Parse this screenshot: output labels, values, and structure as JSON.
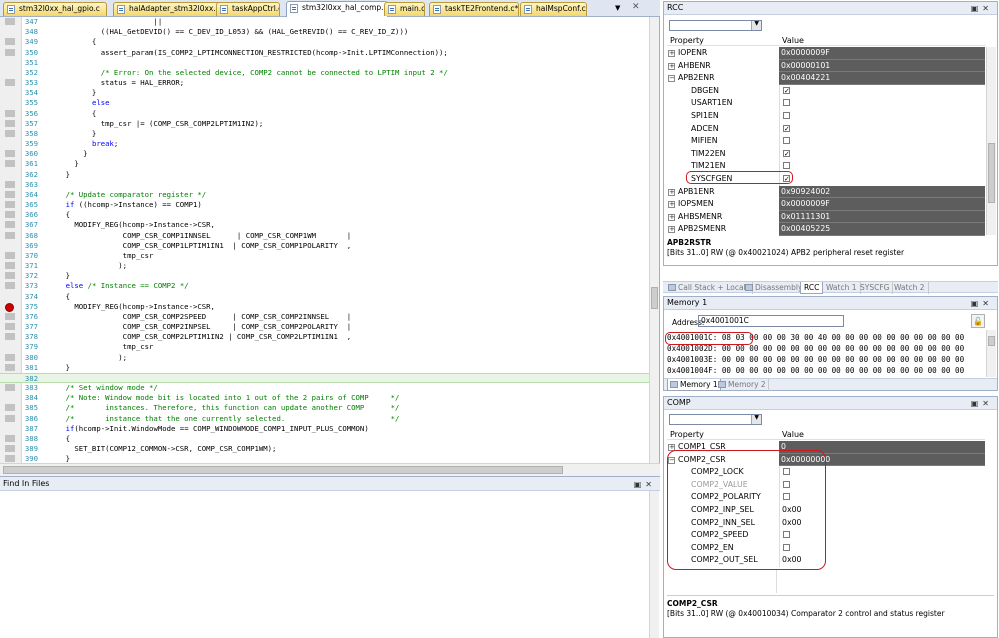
{
  "tabs": [
    {
      "label": "stm32l0xx_hal_gpio.c"
    },
    {
      "label": "halAdapter_stm32l0xx.c"
    },
    {
      "label": "taskAppCtrl.c"
    },
    {
      "label": "stm32l0xx_hal_comp.c"
    },
    {
      "label": "main.c"
    },
    {
      "label": "taskTE2Frontend.c*"
    },
    {
      "label": "halMspConf.c"
    }
  ],
  "code_lines": [
    {
      "n": "347",
      "t": "                        ||"
    },
    {
      "n": "348",
      "t": "            ((HAL_GetDEVID() == C_DEV_ID_L053) && (HAL_GetREVID() == C_REV_ID_Z)))"
    },
    {
      "n": "349",
      "t": "          {"
    },
    {
      "n": "350",
      "t": "            assert_param(IS_COMP2_LPTIMCONNECTION_RESTRICTED(hcomp->Init.LPTIMConnection));"
    },
    {
      "n": "351",
      "t": ""
    },
    {
      "n": "352",
      "t": "            /* Error: On the selected device, COMP2 cannot be connected to LPTIM input 2 */"
    },
    {
      "n": "353",
      "t": "            status = HAL_ERROR;"
    },
    {
      "n": "354",
      "t": "          }"
    },
    {
      "n": "355",
      "t": "          else"
    },
    {
      "n": "356",
      "t": "          {"
    },
    {
      "n": "357",
      "t": "            tmp_csr |= (COMP_CSR_COMP2LPTIM1IN2);"
    },
    {
      "n": "358",
      "t": "          }"
    },
    {
      "n": "359",
      "t": "          break;"
    },
    {
      "n": "360",
      "t": "        }"
    },
    {
      "n": "361",
      "t": "      }"
    },
    {
      "n": "362",
      "t": "    }"
    },
    {
      "n": "363",
      "t": ""
    },
    {
      "n": "364",
      "t": "    /* Update comparator register */"
    },
    {
      "n": "365",
      "t": "    if ((hcomp->Instance) == COMP1)"
    },
    {
      "n": "366",
      "t": "    {"
    },
    {
      "n": "367",
      "t": "      MODIFY_REG(hcomp->Instance->CSR,"
    },
    {
      "n": "368",
      "t": "                 COMP_CSR_COMP1INNSEL      | COMP_CSR_COMP1WM       |"
    },
    {
      "n": "369",
      "t": "                 COMP_CSR_COMP1LPTIM1IN1  | COMP_CSR_COMP1POLARITY  ,"
    },
    {
      "n": "370",
      "t": "                 tmp_csr"
    },
    {
      "n": "371",
      "t": "                );"
    },
    {
      "n": "372",
      "t": "    }"
    },
    {
      "n": "373",
      "t": "    else /* Instance == COMP2 */"
    },
    {
      "n": "374",
      "t": "    {"
    },
    {
      "n": "375",
      "t": "      MODIFY_REG(hcomp->Instance->CSR,"
    },
    {
      "n": "376",
      "t": "                 COMP_CSR_COMP2SPEED      | COMP_CSR_COMP2INNSEL    |"
    },
    {
      "n": "377",
      "t": "                 COMP_CSR_COMP2INPSEL     | COMP_CSR_COMP2POLARITY  |"
    },
    {
      "n": "378",
      "t": "                 COMP_CSR_COMP2LPTIM1IN2 | COMP_CSR_COMP2LPTIM1IN1  ,"
    },
    {
      "n": "379",
      "t": "                 tmp_csr"
    },
    {
      "n": "380",
      "t": "                );"
    },
    {
      "n": "381",
      "t": "    }"
    },
    {
      "n": "382",
      "t": ""
    },
    {
      "n": "383",
      "t": "    /* Set window mode */"
    },
    {
      "n": "384",
      "t": "    /* Note: Window mode bit is located into 1 out of the 2 pairs of COMP     */"
    },
    {
      "n": "385",
      "t": "    /*       instances. Therefore, this function can update another COMP      */"
    },
    {
      "n": "386",
      "t": "    /*       instance that the one currently selected.                        */"
    },
    {
      "n": "387",
      "t": "    if(hcomp->Init.WindowMode == COMP_WINDOWMODE_COMP1_INPUT_PLUS_COMMON)"
    },
    {
      "n": "388",
      "t": "    {"
    },
    {
      "n": "389",
      "t": "      SET_BIT(COMP12_COMMON->CSR, COMP_CSR_COMP1WM);"
    },
    {
      "n": "390",
      "t": "    }"
    }
  ],
  "find_panel": {
    "title": "Find In Files"
  },
  "rcc": {
    "title": "RCC",
    "col_property": "Property",
    "col_value": "Value",
    "rows": [
      {
        "name": "IOPENR",
        "value": "0x0000009F",
        "level": 0,
        "exp": "+"
      },
      {
        "name": "AHBENR",
        "value": "0x00000101",
        "level": 0,
        "exp": "+"
      },
      {
        "name": "APB2ENR",
        "value": "0x00404221",
        "level": 0,
        "exp": "−"
      },
      {
        "name": "DBGEN",
        "value": "✓",
        "level": 1,
        "chk": true
      },
      {
        "name": "USART1EN",
        "value": "",
        "level": 1,
        "chk": true
      },
      {
        "name": "SPI1EN",
        "value": "",
        "level": 1,
        "chk": true
      },
      {
        "name": "ADCEN",
        "value": "✓",
        "level": 1,
        "chk": true
      },
      {
        "name": "MIFIEN",
        "value": "",
        "level": 1,
        "chk": true
      },
      {
        "name": "TIM22EN",
        "value": "✓",
        "level": 1,
        "chk": true
      },
      {
        "name": "TIM21EN",
        "value": "",
        "level": 1,
        "chk": true
      },
      {
        "name": "SYSCFGEN",
        "value": "✓",
        "level": 1,
        "chk": true
      },
      {
        "name": "APB1ENR",
        "value": "0x90924002",
        "level": 0,
        "exp": "+"
      },
      {
        "name": "IOPSMEN",
        "value": "0x0000009F",
        "level": 0,
        "exp": "+"
      },
      {
        "name": "AHBSMENR",
        "value": "0x01111301",
        "level": 0,
        "exp": "+"
      },
      {
        "name": "APB2SMENR",
        "value": "0x00405225",
        "level": 0,
        "exp": "+"
      }
    ],
    "desc_title": "APB2RSTR",
    "desc_text": "[Bits 31..0] RW (@ 0x40021024) APB2 peripheral reset register"
  },
  "mid_tabs": [
    {
      "label": "Call Stack + Locals"
    },
    {
      "label": "Disassembly"
    },
    {
      "label": "RCC"
    },
    {
      "label": "Watch 1"
    },
    {
      "label": "SYSCFG"
    },
    {
      "label": "Watch 2"
    }
  ],
  "memory": {
    "title": "Memory 1",
    "address_label": "Address:",
    "address_value": "0x4001001C",
    "lines": [
      "0x4001001C: 08 03 00 00 00 30 00 40 00 00 00 00 00 00 00 00 00 00",
      "0x4001002D: 00 00 00 00 00 00 00 00 00 00 00 00 00 00 00 00 00 00",
      "0x4001003E: 00 00 00 00 00 00 00 00 00 00 00 00 00 00 00 00 00 00",
      "0x4001004F: 00 00 00 00 00 00 00 00 00 00 00 00 00 00 00 00 00 00"
    ],
    "tabs": [
      {
        "label": "Memory 1"
      },
      {
        "label": "Memory 2"
      }
    ]
  },
  "comp": {
    "title": "COMP",
    "col_property": "Property",
    "col_value": "Value",
    "rows": [
      {
        "name": "COMP1_CSR",
        "value": "0",
        "level": 0,
        "exp": "+"
      },
      {
        "name": "COMP2_CSR",
        "value": "0x00000000",
        "level": 0,
        "exp": "−"
      },
      {
        "name": "COMP2_LOCK",
        "value": "",
        "level": 1,
        "chk": true
      },
      {
        "name": "COMP2_VALUE",
        "value": "",
        "level": 1,
        "chk": true,
        "dim": true
      },
      {
        "name": "COMP2_POLARITY",
        "value": "",
        "level": 1,
        "chk": true
      },
      {
        "name": "COMP2_INP_SEL",
        "value": "0x00",
        "level": 1
      },
      {
        "name": "COMP2_INN_SEL",
        "value": "0x00",
        "level": 1
      },
      {
        "name": "COMP2_SPEED",
        "value": "",
        "level": 1,
        "chk": true
      },
      {
        "name": "COMP2_EN",
        "value": "",
        "level": 1,
        "chk": true
      },
      {
        "name": "COMP2_OUT_SEL",
        "value": "0x00",
        "level": 1
      }
    ],
    "desc_title": "COMP2_CSR",
    "desc_text": "[Bits 31..0] RW (@ 0x40010034) Comparator 2 control and status  register"
  },
  "colors": {
    "highlight": "#d0161f",
    "keyword": "#0000ff",
    "comment": "#008000",
    "value_bg": "#5d5d5d"
  }
}
